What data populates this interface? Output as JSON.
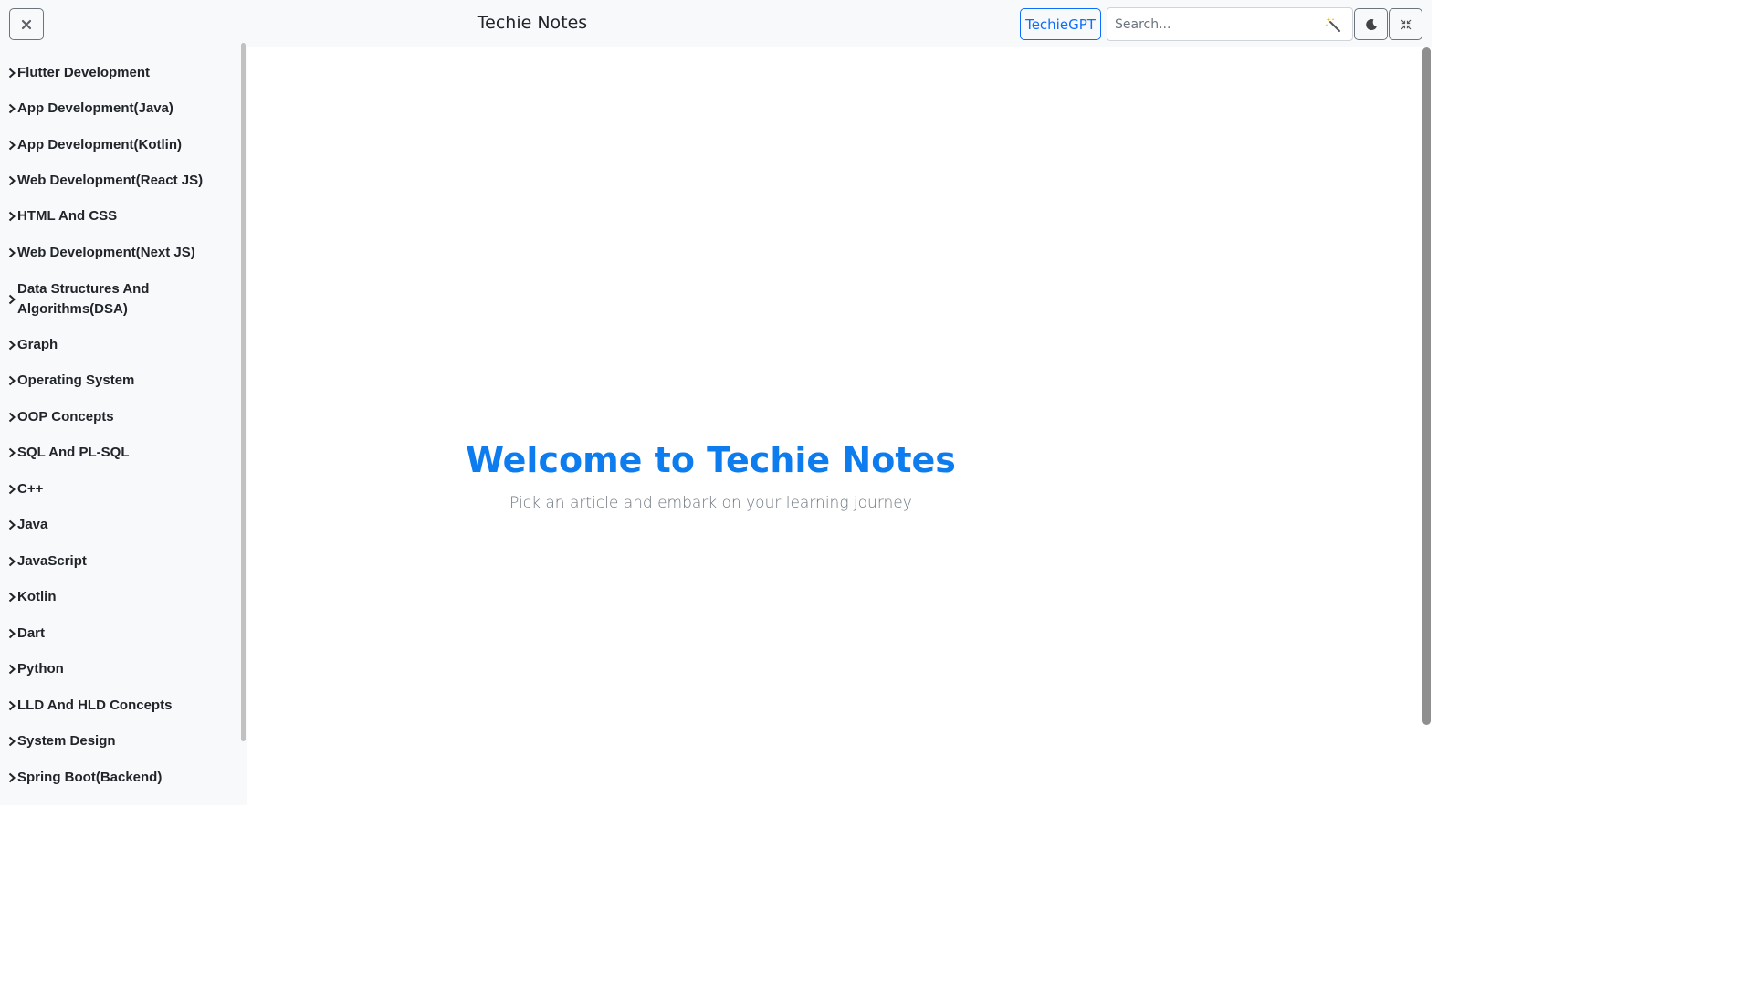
{
  "header": {
    "title": "Techie Notes",
    "gpt_label": "TechieGPT",
    "search_placeholder": "Search...",
    "close_icon": "close-icon",
    "wand_icon": "magic-wand-icon",
    "theme_icon": "moon-icon",
    "fullscreen_icon": "exit-fullscreen-icon"
  },
  "sidebar": {
    "items": [
      {
        "label": "Flutter Development"
      },
      {
        "label": "App Development(Java)"
      },
      {
        "label": "App Development(Kotlin)"
      },
      {
        "label": "Web Development(React JS)"
      },
      {
        "label": "HTML And CSS"
      },
      {
        "label": "Web Development(Next JS)"
      },
      {
        "label": "Data Structures And Algorithms(DSA)"
      },
      {
        "label": "Graph"
      },
      {
        "label": "Operating System"
      },
      {
        "label": "OOP Concepts"
      },
      {
        "label": "SQL And PL-SQL"
      },
      {
        "label": "C++"
      },
      {
        "label": "Java"
      },
      {
        "label": "JavaScript"
      },
      {
        "label": "Kotlin"
      },
      {
        "label": "Dart"
      },
      {
        "label": "Python"
      },
      {
        "label": "LLD And HLD Concepts"
      },
      {
        "label": "System Design"
      },
      {
        "label": "Spring Boot(Backend)"
      }
    ]
  },
  "main": {
    "heading": "Welcome to Techie Notes",
    "subheading": "Pick an article and embark on your learning journey"
  },
  "colors": {
    "accent": "#0d7cef",
    "button_blue": "#0d6efd",
    "sidebar_bg": "#f8f9fb"
  }
}
